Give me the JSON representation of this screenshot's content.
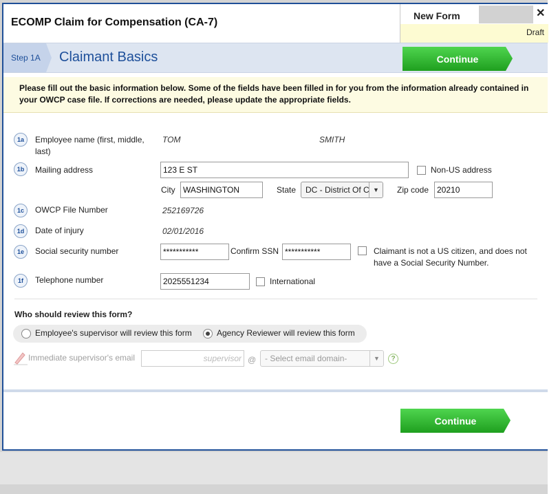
{
  "window": {
    "title": "ECOMP Claim for Compensation (CA-7)",
    "close_glyph": "✕"
  },
  "form_status": {
    "label": "New Form",
    "status": "Draft"
  },
  "step": {
    "number": "Step 1A",
    "title": "Claimant Basics"
  },
  "buttons": {
    "continue": "Continue"
  },
  "notice": "Please fill out the basic information below. Some of the fields have been filled in for you from the information already contained in your OWCP case file. If corrections are needed, please update the appropriate fields.",
  "fields": {
    "employee_name": {
      "badge": "1a",
      "label": "Employee name (first, middle, last)",
      "first": "TOM",
      "last": "SMITH"
    },
    "mailing_address": {
      "badge": "1b",
      "label": "Mailing address",
      "street": "123 E ST",
      "non_us_label": "Non-US address",
      "city_label": "City",
      "city": "WASHINGTON",
      "state_label": "State",
      "state": "DC - District Of Columbia",
      "zip_label": "Zip code",
      "zip": "20210"
    },
    "owcp": {
      "badge": "1c",
      "label": "OWCP File Number",
      "value": "252169726"
    },
    "injury_date": {
      "badge": "1d",
      "label": "Date of injury",
      "value": "02/01/2016"
    },
    "ssn": {
      "badge": "1e",
      "label": "Social security number",
      "value": "***********",
      "confirm_label": "Confirm SSN",
      "confirm_value": "***********",
      "not_citizen_label": "Claimant is not a US citizen, and does not have a Social Security Number."
    },
    "phone": {
      "badge": "1f",
      "label": "Telephone number",
      "value": "2025551234",
      "international_label": "International"
    }
  },
  "review": {
    "question": "Who should review this form?",
    "options": [
      "Employee's supervisor will review this form",
      "Agency Reviewer will review this form"
    ],
    "selected_index": 1,
    "supervisor_email_label": "Immediate supervisor's email",
    "supervisor_placeholder": "supervisor",
    "at_sign": "@",
    "domain_select": "- Select email domain-",
    "help_glyph": "?"
  },
  "colors": {
    "accent": "#1d4f9a",
    "continue": "#2bb52b",
    "notice_bg": "#fdfbe2",
    "step_bar": "#dde5f1"
  }
}
